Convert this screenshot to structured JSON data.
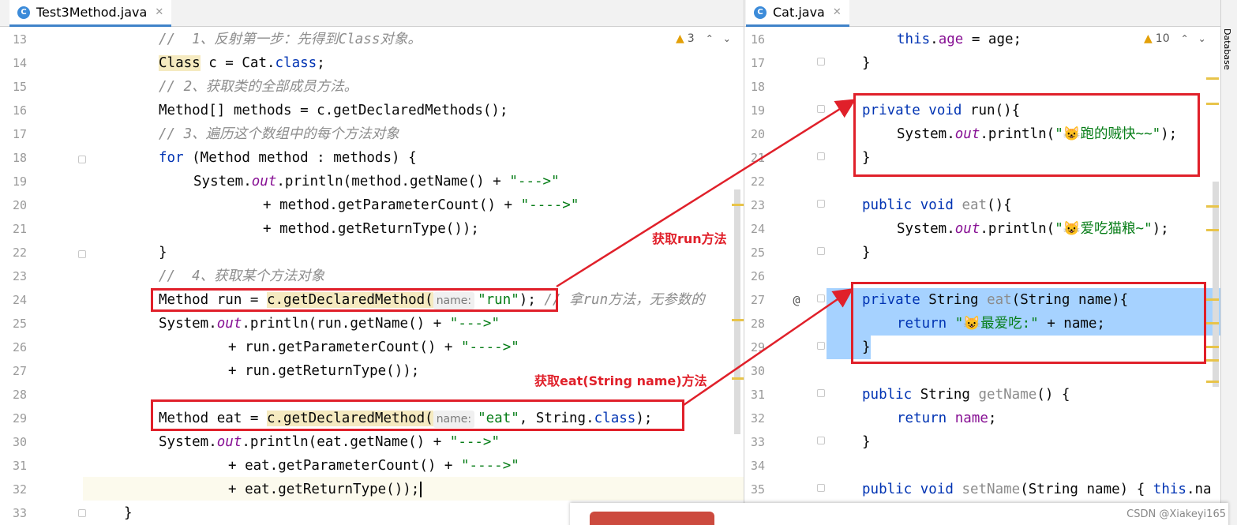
{
  "left_editor": {
    "tab_label": "Test3Method.java",
    "warning_count": "3",
    "line_numbers": [
      "13",
      "14",
      "15",
      "16",
      "17",
      "18",
      "19",
      "20",
      "21",
      "22",
      "23",
      "24",
      "25",
      "26",
      "27",
      "28",
      "29",
      "30",
      "31",
      "32",
      "33"
    ],
    "code": {
      "l13": "//  1、反射第一步：先得到Class对象。",
      "l14_class": "Class",
      "l14_rest": " c = Cat.",
      "l14_kw": "class",
      "l14_end": ";",
      "l15": "// 2、获取类的全部成员方法。",
      "l16": "Method[] methods = c.getDeclaredMethods();",
      "l17": "// 3、遍历这个数组中的每个方法对象",
      "l18_kw": "for",
      "l18_rest": " (Method method : methods) {",
      "l19_a": "System.",
      "l19_out": "out",
      "l19_b": ".println(method.getName() + ",
      "l19_str": "\"--->\"",
      "l20_a": "+ method.getParameterCount() + ",
      "l20_str": "\"---->\"",
      "l21": "+ method.getReturnType());",
      "l22": "}",
      "l23": "//  4、获取某个方法对象",
      "l24_a": "Method run = ",
      "l24_call": "c.getDeclaredMethod(",
      "l24_hint": "name:",
      "l24_str": "\"run\"",
      "l24_end": ");",
      "l24_cm": " // 拿run方法，无参数的",
      "l25_a": "System.",
      "l25_out": "out",
      "l25_b": ".println(run.getName() + ",
      "l25_str": "\"--->\"",
      "l26_a": "+ run.getParameterCount() + ",
      "l26_str": "\"---->\"",
      "l27": "+ run.getReturnType());",
      "l29_a": "Method eat = ",
      "l29_call": "c.getDeclaredMethod(",
      "l29_hint": "name:",
      "l29_str": "\"eat\"",
      "l29_b": ", String.",
      "l29_kw": "class",
      "l29_end": ");",
      "l30_a": "System.",
      "l30_out": "out",
      "l30_b": ".println(eat.getName() + ",
      "l30_str": "\"--->\"",
      "l31_a": "+ eat.getParameterCount() + ",
      "l31_str": "\"---->\"",
      "l32": "+ eat.getReturnType());",
      "l33": "}"
    }
  },
  "right_editor": {
    "tab_label": "Cat.java",
    "warning_count": "10",
    "line_numbers": [
      "16",
      "17",
      "18",
      "19",
      "20",
      "21",
      "22",
      "23",
      "24",
      "25",
      "26",
      "27",
      "28",
      "29",
      "30",
      "31",
      "32",
      "33",
      "34",
      "35"
    ],
    "code": {
      "r16_kw": "this",
      "r16_a": ".",
      "r16_fld": "age",
      "r16_b": " = age;",
      "r17": "}",
      "r19_kw": "private void",
      "r19_a": " run(){",
      "r20_a": "System.",
      "r20_out": "out",
      "r20_b": ".println(",
      "r20_str": "\"😺跑的贼快~~\"",
      "r20_end": ");",
      "r21": "}",
      "r23_kw": "public void",
      "r23_a": " ",
      "r23_gray": "eat",
      "r23_b": "(){",
      "r24_a": "System.",
      "r24_out": "out",
      "r24_b": ".println(",
      "r24_str": "\"😺爱吃猫粮~\"",
      "r24_end": ");",
      "r25": "}",
      "r27_gutter": "@",
      "r27_kw": "private",
      "r27_a": " String ",
      "r27_gray": "eat",
      "r27_b": "(String name){",
      "r28_kw": "return",
      "r28_a": " ",
      "r28_str": "\"😺最爱吃:\"",
      "r28_b": " + name;",
      "r29": "}",
      "r31_kw": "public",
      "r31_a": " String ",
      "r31_gray": "getName",
      "r31_b": "() {",
      "r32_kw": "return",
      "r32_a": " ",
      "r32_fld": "name",
      "r32_b": ";",
      "r33": "}",
      "r35_kw": "public void",
      "r35_a": " ",
      "r35_gray": "setName",
      "r35_b": "(String name) { ",
      "r35_kw2": "this",
      "r35_c": ".na"
    }
  },
  "annotations": {
    "run_label": "获取run方法",
    "eat_label": "获取eat(String name)方法"
  },
  "sidebar": {
    "database_label": "Database"
  },
  "watermark": "CSDN @Xiakeyi165",
  "colors": {
    "keyword": "#0033b3",
    "string": "#067d17",
    "comment": "#8c8c8c",
    "annotation_red": "#e0202a",
    "selection": "#a6d2ff"
  }
}
